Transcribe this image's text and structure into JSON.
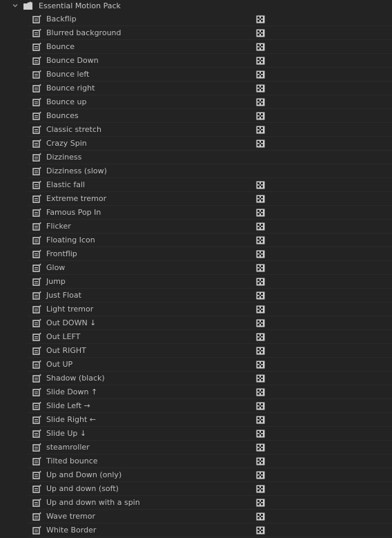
{
  "folder": {
    "label": "Essential Motion Pack",
    "icon": "folder-preset-icon",
    "expanded": true
  },
  "items": [
    {
      "label": "Backflip",
      "accelerated": true
    },
    {
      "label": "Blurred background",
      "accelerated": true
    },
    {
      "label": "Bounce",
      "accelerated": true
    },
    {
      "label": "Bounce Down",
      "accelerated": true
    },
    {
      "label": "Bounce left",
      "accelerated": true
    },
    {
      "label": "Bounce right",
      "accelerated": true
    },
    {
      "label": "Bounce up",
      "accelerated": true
    },
    {
      "label": "Bounces",
      "accelerated": true
    },
    {
      "label": "Classic stretch",
      "accelerated": true
    },
    {
      "label": "Crazy Spin",
      "accelerated": true
    },
    {
      "label": "Dizziness",
      "accelerated": false
    },
    {
      "label": "Dizziness (slow)",
      "accelerated": false
    },
    {
      "label": "Elastic fall",
      "accelerated": true
    },
    {
      "label": "Extreme tremor",
      "accelerated": true
    },
    {
      "label": "Famous Pop In",
      "accelerated": true
    },
    {
      "label": "Flicker",
      "accelerated": true
    },
    {
      "label": "Floating Icon",
      "accelerated": true
    },
    {
      "label": "Frontflip",
      "accelerated": true
    },
    {
      "label": "Glow",
      "accelerated": true
    },
    {
      "label": "Jump",
      "accelerated": true
    },
    {
      "label": "Just Float",
      "accelerated": true
    },
    {
      "label": "Light tremor",
      "accelerated": true
    },
    {
      "label": "Out DOWN ↓",
      "accelerated": true
    },
    {
      "label": "Out LEFT",
      "accelerated": true
    },
    {
      "label": "Out RIGHT",
      "accelerated": true
    },
    {
      "label": "Out UP",
      "accelerated": true
    },
    {
      "label": "Shadow (black)",
      "accelerated": true
    },
    {
      "label": "Slide Down ↑",
      "accelerated": true
    },
    {
      "label": "Slide Left →",
      "accelerated": true
    },
    {
      "label": "Slide Right ←",
      "accelerated": true
    },
    {
      "label": "Slide Up ↓",
      "accelerated": true
    },
    {
      "label": "steamroller",
      "accelerated": true
    },
    {
      "label": "Tilted bounce",
      "accelerated": true
    },
    {
      "label": "Up and Down (only)",
      "accelerated": true
    },
    {
      "label": "Up and down (soft)",
      "accelerated": true
    },
    {
      "label": "Up and down with a spin",
      "accelerated": true
    },
    {
      "label": "Wave tremor",
      "accelerated": true
    },
    {
      "label": "White Border",
      "accelerated": true
    }
  ],
  "icons": {
    "preset": "effect-preset-icon",
    "accelerated": "accelerated-effect-icon",
    "chevron": "chevron-down-icon"
  },
  "colors": {
    "background": "#232323",
    "text": "#bdbdbd",
    "icon": "#cfcfcf"
  }
}
